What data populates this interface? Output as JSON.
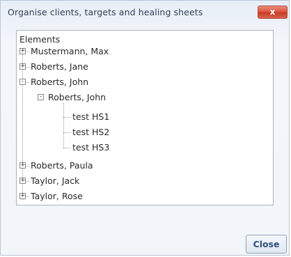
{
  "window": {
    "title": "Organise clients, targets and healing sheets",
    "close_glyph": "x"
  },
  "tree": {
    "root_label": "Elements",
    "expand_glyph": "+",
    "collapse_glyph": "-",
    "nodes": [
      {
        "label": "Mustermann, Max",
        "expanded": false
      },
      {
        "label": "Roberts, Jane",
        "expanded": false
      },
      {
        "label": "Roberts, John",
        "expanded": true,
        "child": {
          "label": "Roberts, John",
          "expanded": true,
          "children": [
            "test HS1",
            "test HS2",
            "test HS3"
          ]
        }
      },
      {
        "label": "Roberts, Paula",
        "expanded": false
      },
      {
        "label": "Taylor, Jack",
        "expanded": false
      },
      {
        "label": "Taylor, Rose",
        "expanded": false
      }
    ]
  },
  "footer": {
    "close_label": "Close"
  },
  "colors": {
    "title_text": "#2f3e55",
    "close_x_bg": "#d9523c",
    "close_button_text": "#2d4f7c",
    "tree_border": "#a7b3c3"
  }
}
